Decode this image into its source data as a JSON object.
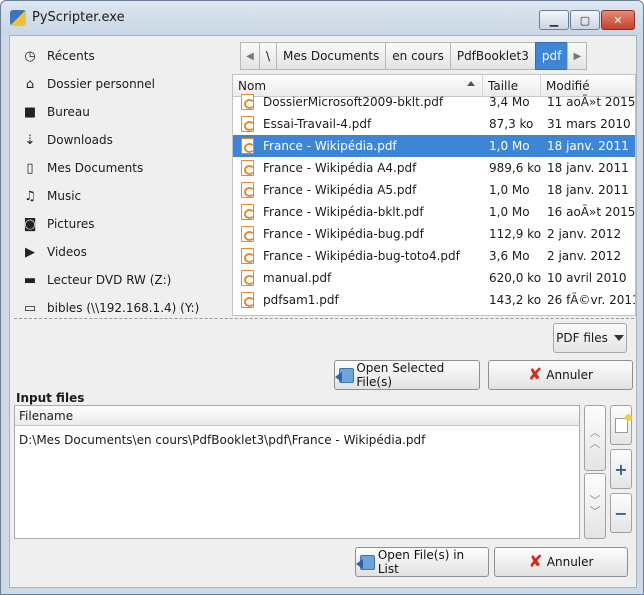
{
  "window": {
    "title": "PyScripter.exe"
  },
  "places": [
    {
      "label": "Récents",
      "icon": "clock-icon"
    },
    {
      "label": "Dossier personnel",
      "icon": "home-icon"
    },
    {
      "label": "Bureau",
      "icon": "folder-icon"
    },
    {
      "label": "Downloads",
      "icon": "download-icon"
    },
    {
      "label": "Mes Documents",
      "icon": "document-icon"
    },
    {
      "label": "Music",
      "icon": "music-icon"
    },
    {
      "label": "Pictures",
      "icon": "camera-icon"
    },
    {
      "label": "Videos",
      "icon": "video-icon"
    },
    {
      "label": "Lecteur DVD RW (Z:)",
      "icon": "disc-drive-icon"
    },
    {
      "label": "bibles (\\\\192.168.1.4) (Y:)",
      "icon": "network-drive-icon"
    }
  ],
  "path": {
    "root": "\\",
    "segments": [
      "Mes Documents",
      "en cours",
      "PdfBooklet3",
      "pdf"
    ],
    "active": "pdf"
  },
  "file_table": {
    "columns": [
      "Nom",
      "Taille",
      "Modifié"
    ],
    "rows": [
      {
        "name": "DossierMicrosoft2009-bklt.pdf",
        "size": "3,4 Mo",
        "modified": "11 aoÃ»t 2015"
      },
      {
        "name": "Essai-Travail-4.pdf",
        "size": "87,3 ko",
        "modified": "31 mars 2010"
      },
      {
        "name": "France - Wikipédia.pdf",
        "size": "1,0 Mo",
        "modified": "18 janv. 2011",
        "selected": true
      },
      {
        "name": "France - Wikipédia A4.pdf",
        "size": "989,6 ko",
        "modified": "18 janv. 2011"
      },
      {
        "name": "France - Wikipédia A5.pdf",
        "size": "1,0 Mo",
        "modified": "18 janv. 2011"
      },
      {
        "name": "France - Wikipédia-bklt.pdf",
        "size": "1,0 Mo",
        "modified": "16 aoÃ»t 2015"
      },
      {
        "name": "France - Wikipédia-bug.pdf",
        "size": "112,9 ko",
        "modified": "2 janv. 2012"
      },
      {
        "name": "France - Wikipédia-bug-toto4.pdf",
        "size": "3,6 Mo",
        "modified": "2 janv. 2012"
      },
      {
        "name": "manual.pdf",
        "size": "620,0 ko",
        "modified": "10 avril 2010"
      },
      {
        "name": "pdfsam1.pdf",
        "size": "143,2 ko",
        "modified": "26 fÃ©vr. 2011"
      }
    ]
  },
  "filter": {
    "selected": "PDF files"
  },
  "buttons": {
    "open_selected": "Open Selected File(s)",
    "cancel": "Annuler",
    "open_in_list": "Open File(s) in List",
    "cancel2": "Annuler"
  },
  "input_files": {
    "title": "Input files",
    "column": "Filename",
    "rows": [
      "D:\\Mes Documents\\en cours\\PdfBooklet3\\pdf\\France - Wikipédia.pdf"
    ]
  },
  "colors": {
    "selection": "#3d86d6",
    "title_bar": "#c9d6e5",
    "cancel_icon": "#d02b1d"
  }
}
